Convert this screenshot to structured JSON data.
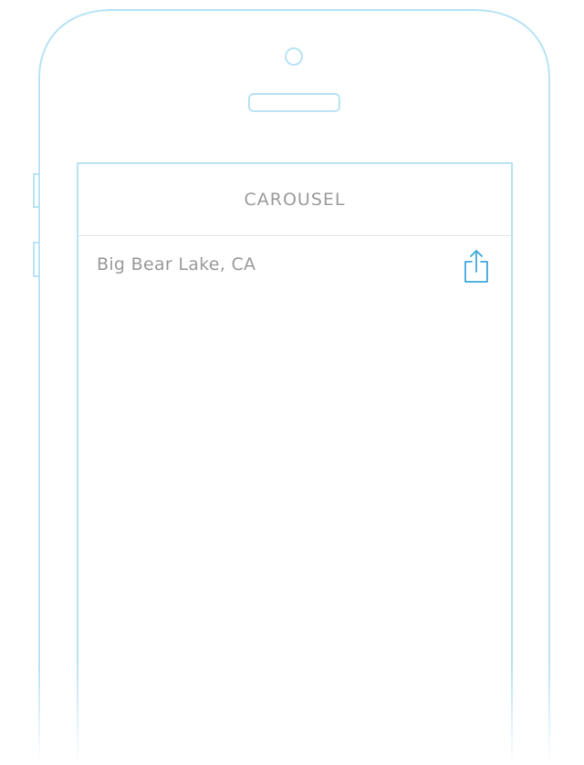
{
  "screen": {
    "title": "CAROUSEL",
    "location": "Big Bear Lake, CA"
  },
  "icons": {
    "share": "share-icon",
    "camera": "camera-icon",
    "speaker": "speaker-icon"
  },
  "colors": {
    "outline": "#b9e3f5",
    "accent": "#3aa6dd",
    "text": "#9a9a9a"
  }
}
